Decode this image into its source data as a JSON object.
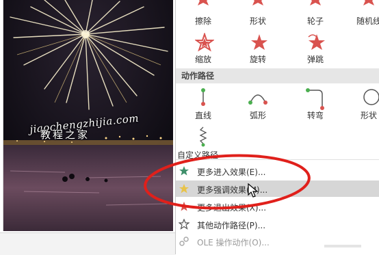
{
  "effects_top": [
    {
      "label": "擦除",
      "icon": "wipe-icon"
    },
    {
      "label": "形状",
      "icon": "shape-icon"
    },
    {
      "label": "轮子",
      "icon": "wheel-icon"
    },
    {
      "label": "随机线",
      "icon": "random-bars-icon"
    }
  ],
  "effects_row2": [
    {
      "label": "缩放",
      "icon": "zoom-icon"
    },
    {
      "label": "旋转",
      "icon": "swivel-icon"
    },
    {
      "label": "弹跳",
      "icon": "bounce-icon"
    }
  ],
  "motion_paths_header": "动作路径",
  "motion_paths": [
    {
      "label": "直线",
      "icon": "line-path-icon"
    },
    {
      "label": "弧形",
      "icon": "arc-path-icon"
    },
    {
      "label": "转弯",
      "icon": "turn-path-icon"
    },
    {
      "label": "形状",
      "icon": "shape-path-icon"
    }
  ],
  "custom_path_label": "自定义路径",
  "commands": [
    {
      "label": "更多进入效果(E)...",
      "icon": "star-green-icon",
      "highlighted": false,
      "enabled": true
    },
    {
      "label": "更多强调效果(M)...",
      "icon": "star-yellow-icon",
      "highlighted": true,
      "enabled": true
    },
    {
      "label": "更多退出效果(X)...",
      "icon": "star-red-icon",
      "highlighted": false,
      "enabled": true
    },
    {
      "label": "其他动作路径(P)...",
      "icon": "star-outline-icon",
      "highlighted": false,
      "enabled": true
    },
    {
      "label": "OLE 操作动作(O)...",
      "icon": "gear-icon",
      "highlighted": false,
      "enabled": false
    }
  ],
  "watermark": {
    "line1": "jiaochengzhijia.com",
    "line2": "教程之家"
  },
  "colors": {
    "accent_red": "#d9534f",
    "annotation": "#e0201b",
    "section_bg": "#e6e6e6"
  }
}
